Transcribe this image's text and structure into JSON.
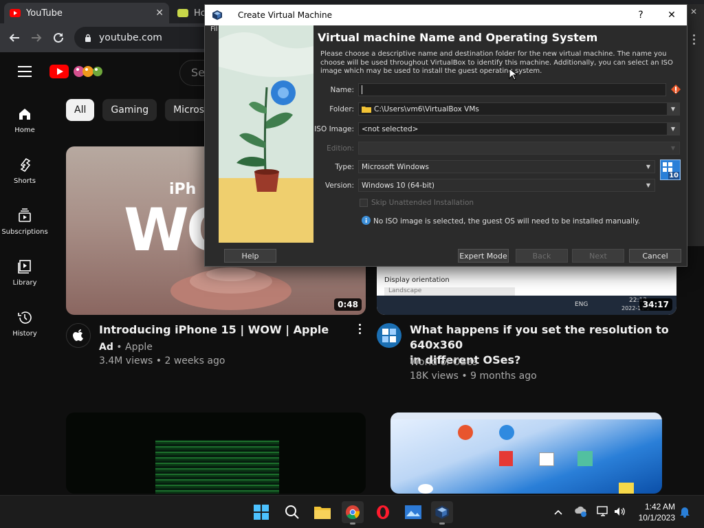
{
  "browser": {
    "tabs": [
      {
        "title": "YouTube",
        "close": "✕"
      },
      {
        "title": "Ho"
      }
    ],
    "url": "youtube.com"
  },
  "youtube": {
    "search_placeholder": "Se",
    "guide": [
      {
        "label": "Home",
        "icon": "home-icon"
      },
      {
        "label": "Shorts",
        "icon": "shorts-icon"
      },
      {
        "label": "Subscriptions",
        "icon": "subscriptions-icon"
      },
      {
        "label": "Library",
        "icon": "library-icon"
      },
      {
        "label": "History",
        "icon": "history-icon"
      }
    ],
    "chips": [
      "All",
      "Gaming",
      "Microsof"
    ],
    "videos": [
      {
        "title": "Introducing iPhone 15 | WOW | Apple",
        "ad": "Ad",
        "channel": "Apple",
        "stats": "3.4M views • 2 weeks ago",
        "duration": "0:48",
        "thumb_text": "iPh",
        "thumb_big": "WO"
      },
      {
        "title_line1": "What happens if you set the resolution to 640x360",
        "title_line2": "in different OSes?",
        "channel": "World of OSes",
        "stats": "18K views • 9 months ago",
        "duration": "34:17",
        "thumb_text": "Display orientation",
        "thumb_sub": "Landscape",
        "thumb_time": "22:12",
        "thumb_date": "2022-11-2",
        "thumb_lang": "ENG"
      }
    ]
  },
  "vbox": {
    "window_title": "Create Virtual Machine",
    "help_glyph": "?",
    "close_glyph": "✕",
    "menu_peek": "Fil",
    "heading": "Virtual machine Name and Operating System",
    "description": "Please choose a descriptive name and destination folder for the new virtual machine. The name you choose will be used throughout VirtualBox to identify this machine. Additionally, you can select an ISO image which may be used to install the guest operating system.",
    "fields": {
      "name_label": "Name:",
      "name_value": "",
      "folder_label": "Folder:",
      "folder_value": "C:\\Users\\vm6\\VirtualBox VMs",
      "iso_label": "ISO Image:",
      "iso_value": "<not selected>",
      "edition_label": "Edition:",
      "edition_value": "",
      "type_label": "Type:",
      "type_value": "Microsoft Windows",
      "version_label": "Version:",
      "version_value": "Windows 10 (64-bit)",
      "os_badge": "10"
    },
    "skip_unattended": "Skip Unattended Installation",
    "info_text": "No ISO image is selected, the guest OS will need to be installed manually.",
    "buttons": {
      "help": "Help",
      "expert": "Expert Mode",
      "back": "Back",
      "next": "Next",
      "cancel": "Cancel"
    }
  },
  "taskbar": {
    "time": "1:42 AM",
    "date": "10/1/2023",
    "apps": [
      "windows-start-icon",
      "search-icon",
      "file-explorer-icon",
      "chrome-icon",
      "opera-icon",
      "photos-icon",
      "virtualbox-icon"
    ]
  },
  "colors": {
    "yt_red": "#ff0000",
    "yt_bg": "#0f0f0f",
    "vbox_bg": "#2b2b2b",
    "info_blue": "#3d8fd8"
  }
}
